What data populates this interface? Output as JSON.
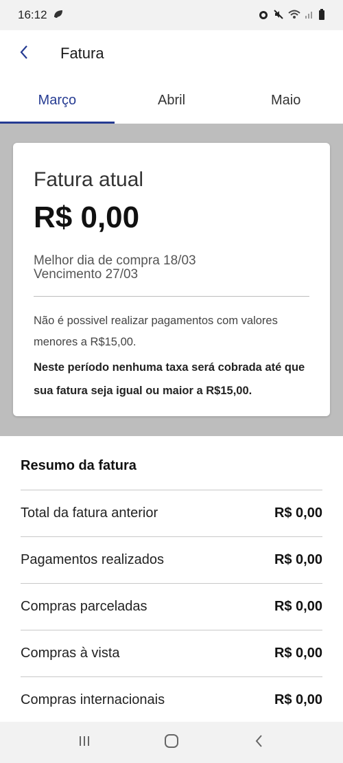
{
  "status_bar": {
    "time": "16:12",
    "icons": [
      "leaf-icon",
      "alarm-icon",
      "mute-icon",
      "wifi-icon",
      "signal-icon",
      "battery-icon"
    ]
  },
  "header": {
    "title": "Fatura",
    "back_icon": "chevron-left-icon"
  },
  "tabs": [
    {
      "label": "Março",
      "active": true
    },
    {
      "label": "Abril",
      "active": false
    },
    {
      "label": "Maio",
      "active": false
    }
  ],
  "invoice_card": {
    "label": "Fatura atual",
    "amount": "R$ 0,00",
    "best_purchase_day": "Melhor dia de compra 18/03",
    "due_date": "Vencimento 27/03",
    "note": "Não é possivel realizar pagamentos com valores menores a R$15,00.",
    "note_bold": "Neste período nenhuma taxa será cobrada até que sua fatura seja igual ou maior a R$15,00."
  },
  "summary": {
    "title": "Resumo da fatura",
    "rows": [
      {
        "label": "Total da fatura anterior",
        "value": "R$ 0,00"
      },
      {
        "label": "Pagamentos realizados",
        "value": "R$ 0,00"
      },
      {
        "label": "Compras parceladas",
        "value": "R$ 0,00"
      },
      {
        "label": "Compras à vista",
        "value": "R$ 0,00"
      },
      {
        "label": "Compras internacionais",
        "value": "R$ 0,00"
      }
    ]
  },
  "nav_bar": {
    "icons": [
      "recent-apps-icon",
      "home-icon",
      "back-icon"
    ]
  },
  "colors": {
    "accent": "#253b92",
    "gray_background": "#bdbdbd"
  }
}
